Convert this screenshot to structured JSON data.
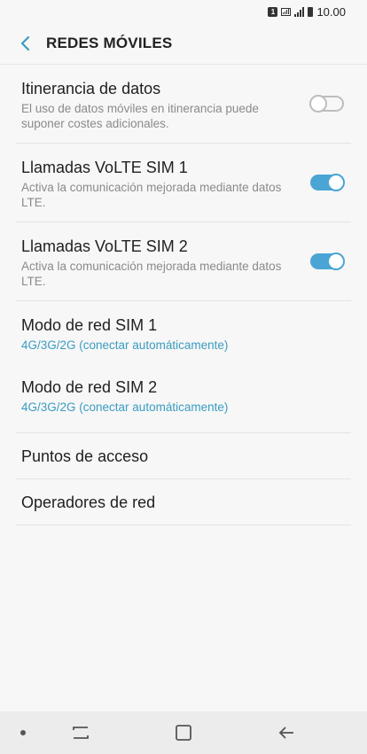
{
  "status_bar": {
    "sim_badge": "1",
    "time": "10.00"
  },
  "header": {
    "title": "REDES MÓVILES",
    "back_icon": "chevron-left-icon"
  },
  "colors": {
    "accent": "#4aa5d4",
    "accent_text": "#3a9cc0",
    "background": "#f7f7f7",
    "toggle_off": "#bdbdbd"
  },
  "items": [
    {
      "title": "Itinerancia de datos",
      "subtitle": "El uso de datos móviles en itinerancia puede suponer costes adicionales.",
      "toggle": false
    },
    {
      "title": "Llamadas VoLTE SIM 1",
      "subtitle": "Activa la comunicación mejorada mediante datos LTE.",
      "toggle": true
    },
    {
      "title": "Llamadas VoLTE SIM 2",
      "subtitle": "Activa la comunicación mejorada mediante datos LTE.",
      "toggle": true
    },
    {
      "title": "Modo de red SIM 1",
      "value": "4G/3G/2G (conectar automáticamente)"
    },
    {
      "title": "Modo de red SIM 2",
      "value": "4G/3G/2G (conectar automáticamente)"
    },
    {
      "title": "Puntos de acceso"
    },
    {
      "title": "Operadores de red"
    }
  ],
  "nav_bar": {
    "dot_icon": "dot-icon",
    "recents_icon": "recents-icon",
    "home_icon": "home-icon",
    "back_icon": "back-arrow-icon"
  }
}
